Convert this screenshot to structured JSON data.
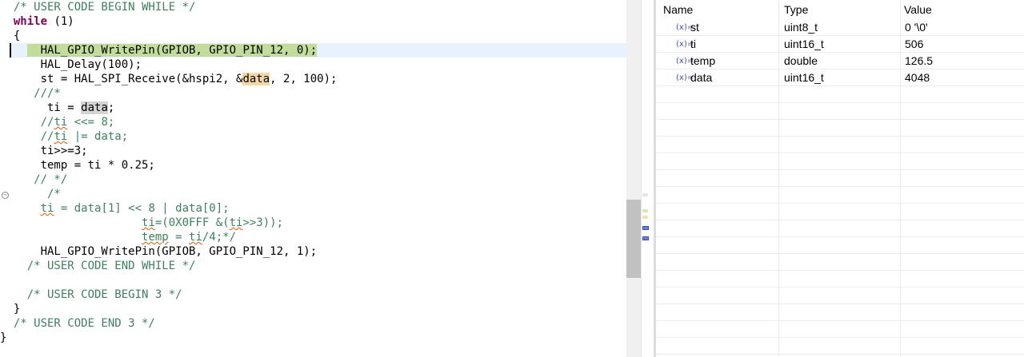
{
  "editor": {
    "lines": [
      "  /* USER CODE BEGIN WHILE */",
      "  while (1)",
      "  {",
      "      HAL_GPIO_WritePin(GPIOB, GPIO_PIN_12, 0);",
      "      HAL_Delay(100);",
      "      st = HAL_SPI_Receive(&hspi2, &data, 2, 100);",
      "     ///*",
      "       ti = data;",
      "      //ti <<= 8;",
      "      //ti |= data;",
      "      ti>>=3;",
      "      temp = ti * 0.25;",
      "     // */",
      "       /*",
      "      ti = data[1] << 8 | data[0];",
      "                     ti=(0X0FFF &(ti>>3));",
      "                     temp = ti/4;*/",
      "      HAL_GPIO_WritePin(GPIOB, GPIO_PIN_12, 1);",
      "    /* USER CODE END WHILE */",
      "",
      "    /* USER CODE BEGIN 3 */",
      "  }",
      "  /* USER CODE END 3 */",
      "}"
    ]
  },
  "variables": {
    "columns": [
      "Name",
      "Type",
      "Value"
    ],
    "rows": [
      {
        "icon": "variable-icon",
        "icon_glyph": "(x)=",
        "name": "st",
        "type": "uint8_t",
        "value": "0 '\\0'"
      },
      {
        "icon": "variable-icon",
        "icon_glyph": "(x)=",
        "name": "ti",
        "type": "uint16_t",
        "value": "506"
      },
      {
        "icon": "variable-icon",
        "icon_glyph": "(x)=",
        "name": "temp",
        "type": "double",
        "value": "126.5"
      },
      {
        "icon": "variable-icon",
        "icon_glyph": "(x)=",
        "name": "data",
        "type": "uint16_t",
        "value": "4048"
      }
    ]
  },
  "colors": {
    "keyword": "#7f0055",
    "comment": "#3f7f5f",
    "current_line": "#e8f2fe",
    "highlight_green": "#c2dc9c",
    "highlight_orange": "#f3d8a7"
  }
}
